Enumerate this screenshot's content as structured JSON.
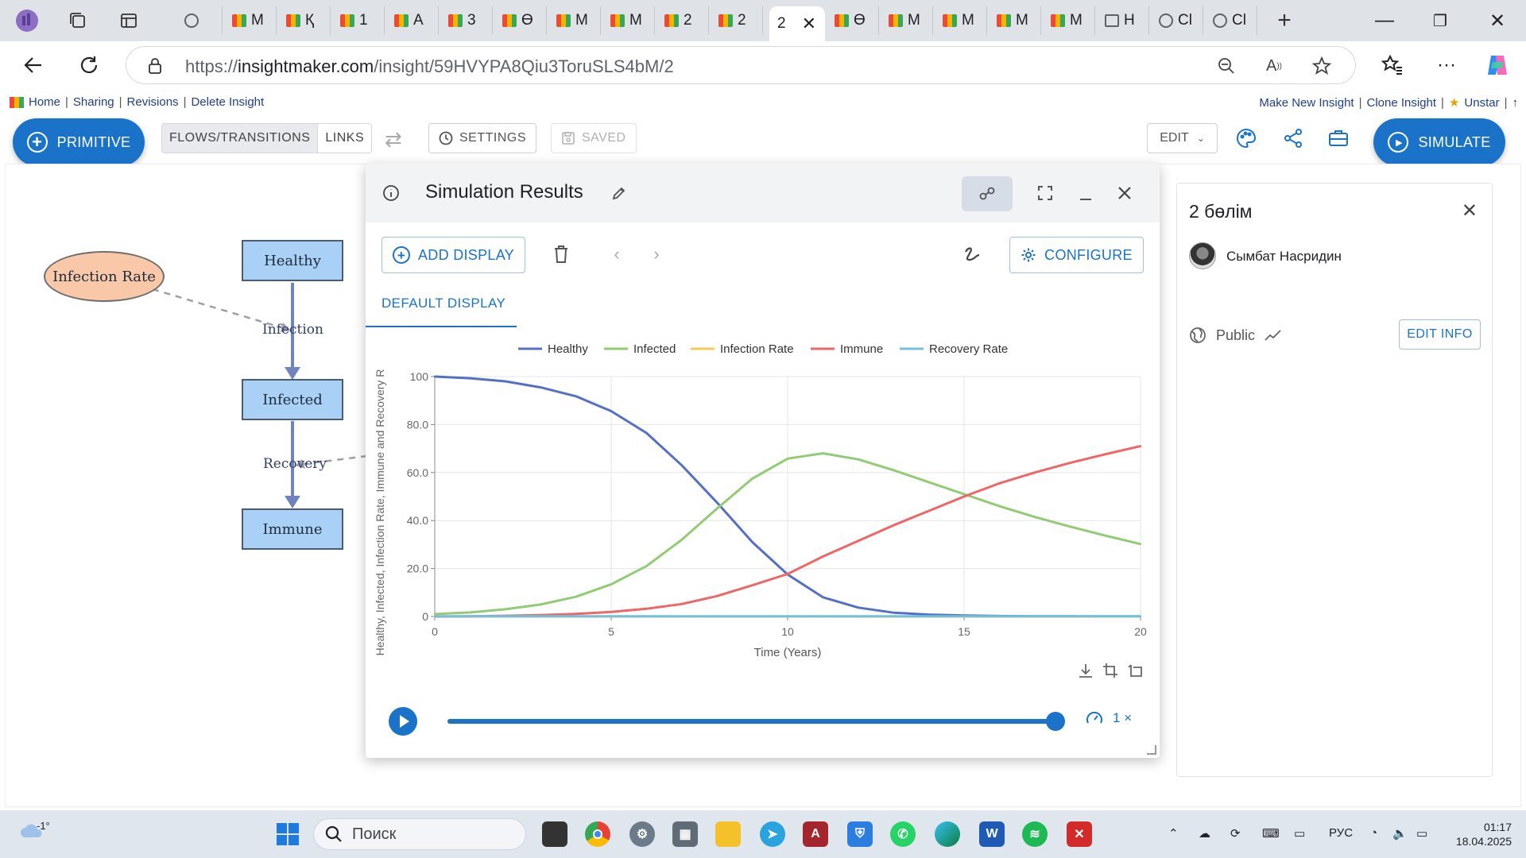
{
  "browser": {
    "tabs": [
      {
        "label": "М",
        "fav": "im"
      },
      {
        "label": "Қ",
        "fav": "im"
      },
      {
        "label": "1",
        "fav": "im"
      },
      {
        "label": "А",
        "fav": "im"
      },
      {
        "label": "3",
        "fav": "im"
      },
      {
        "label": "Ө",
        "fav": "im"
      },
      {
        "label": "М",
        "fav": "im"
      },
      {
        "label": "М",
        "fav": "im"
      },
      {
        "label": "2",
        "fav": "im"
      },
      {
        "label": "2",
        "fav": "im"
      }
    ],
    "active_tab": "2",
    "tabs_after": [
      {
        "label": "Ө",
        "fav": "im"
      },
      {
        "label": "М",
        "fav": "im"
      },
      {
        "label": "М",
        "fav": "im"
      },
      {
        "label": "М",
        "fav": "im"
      },
      {
        "label": "М",
        "fav": "im"
      },
      {
        "label": "Н",
        "fav": "pg"
      },
      {
        "label": "Cl",
        "fav": "gl"
      },
      {
        "label": "Cl",
        "fav": "gl"
      }
    ],
    "url_prefix": "https://",
    "url_domain": "insightmaker.com",
    "url_path": "/insight/59HVYPA8Qiu3ToruSLS4bM/2"
  },
  "header_links": {
    "left": [
      "Home",
      "Sharing",
      "Revisions",
      "Delete Insight"
    ],
    "right": [
      "Make New Insight",
      "Clone Insight",
      "Unstar"
    ],
    "right_tail": "↑"
  },
  "toolbar": {
    "primitive_label": "PRIMITIVE",
    "flows_label": "FLOWS/TRANSITIONS",
    "links_label": "LINKS",
    "settings_label": "SETTINGS",
    "saved_label": "SAVED",
    "edit_label": "EDIT",
    "simulate_label": "SIMULATE"
  },
  "model": {
    "variable": "Infection Rate",
    "stocks": [
      "Healthy",
      "Infected",
      "Immune"
    ],
    "flows": [
      "Infection",
      "Recovery"
    ]
  },
  "sim_window": {
    "title": "Simulation Results",
    "add_display_label": "ADD DISPLAY",
    "configure_label": "CONFIGURE",
    "display_tab": "DEFAULT DISPLAY",
    "speed_label": "1 ×",
    "progress": 1.0
  },
  "chart_data": {
    "type": "line",
    "xlabel": "Time (Years)",
    "ylabel": "Healthy, Infected, Infection Rate, Immune and Recovery R",
    "xlim": [
      0,
      20
    ],
    "ylim": [
      0,
      100
    ],
    "xticks": [
      0,
      5,
      10,
      15,
      20
    ],
    "yticks": [
      "0",
      "20.0",
      "40.0",
      "60.0",
      "80.0",
      "100"
    ],
    "grid": true,
    "legend_position": "top",
    "x": [
      0,
      1,
      2,
      3,
      4,
      5,
      6,
      7,
      8,
      9,
      10,
      11,
      12,
      13,
      14,
      15,
      16,
      17,
      18,
      19,
      20
    ],
    "series": [
      {
        "name": "Healthy",
        "color": "#5470c6",
        "values": [
          100,
          99.3,
          98,
          95.5,
          91.8,
          85.6,
          76.5,
          63,
          47.5,
          31,
          17.5,
          8,
          3.7,
          1.6,
          0.8,
          0.4,
          0.2,
          0.1,
          0.05,
          0.03,
          0.02
        ]
      },
      {
        "name": "Infected",
        "color": "#91cc75",
        "values": [
          1,
          1.7,
          3,
          5,
          8.2,
          13.4,
          21,
          32,
          45,
          57.5,
          65.8,
          68,
          65.5,
          61,
          56,
          51,
          46,
          41.5,
          37.5,
          33.7,
          30.2
        ]
      },
      {
        "name": "Infection Rate",
        "color": "#fac858",
        "values": [
          0,
          0,
          0,
          0,
          0,
          0,
          0,
          0,
          0,
          0,
          0,
          0,
          0,
          0,
          0,
          0,
          0,
          0,
          0,
          0,
          0
        ]
      },
      {
        "name": "Immune",
        "color": "#ee6666",
        "values": [
          0,
          0.1,
          0.3,
          0.6,
          1.1,
          1.9,
          3.2,
          5.2,
          8.5,
          13,
          17.7,
          25,
          31.5,
          38,
          44,
          50,
          55.5,
          60,
          64,
          67.6,
          71
        ]
      },
      {
        "name": "Recovery Rate",
        "color": "#73c0de",
        "values": [
          0.1,
          0.1,
          0.1,
          0.1,
          0.1,
          0.1,
          0.1,
          0.1,
          0.1,
          0.1,
          0.1,
          0.1,
          0.1,
          0.1,
          0.1,
          0.1,
          0.1,
          0.1,
          0.1,
          0.1,
          0.1
        ]
      }
    ]
  },
  "info_panel": {
    "title": "2 бөлім",
    "author": "Сымбат Насридин",
    "visibility": "Public",
    "edit_info_label": "EDIT INFO"
  },
  "taskbar": {
    "weather": "-1°",
    "search_placeholder": "Поиск",
    "language": "РУС",
    "time": "01:17",
    "date": "18.04.2025"
  }
}
